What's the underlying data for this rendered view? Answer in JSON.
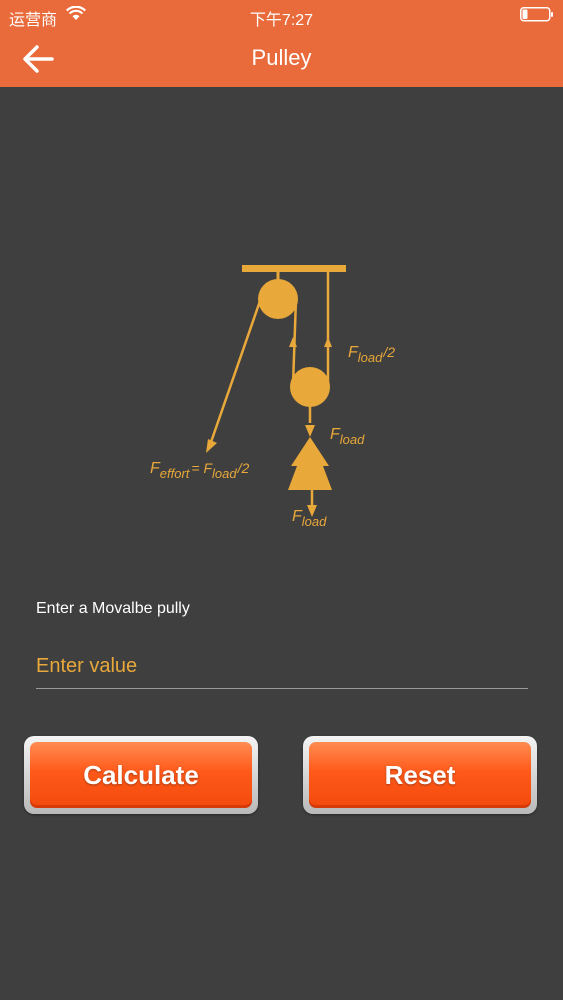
{
  "status_bar": {
    "carrier": "运营商",
    "time": "下午7:27"
  },
  "nav": {
    "title": "Pulley",
    "back_icon": "arrow-left-icon"
  },
  "diagram": {
    "load_half": "F",
    "load_half_sub": "load",
    "load_half_div": "/2",
    "load_mid": "F",
    "load_mid_sub": "load",
    "effort": "F",
    "effort_sub": "effort",
    "effort_eq": "= F",
    "effort_load_sub": "load",
    "effort_div": "/2",
    "load_bottom": "F",
    "load_bottom_sub": "load",
    "accent_color": "#e8a83a"
  },
  "form": {
    "label": "Enter a Movalbe pully",
    "placeholder": "Enter value"
  },
  "buttons": {
    "calculate": "Calculate",
    "reset": "Reset"
  },
  "colors": {
    "header": "#e96a3a",
    "background": "#3f3f3f",
    "button": "#ff5a1a"
  }
}
